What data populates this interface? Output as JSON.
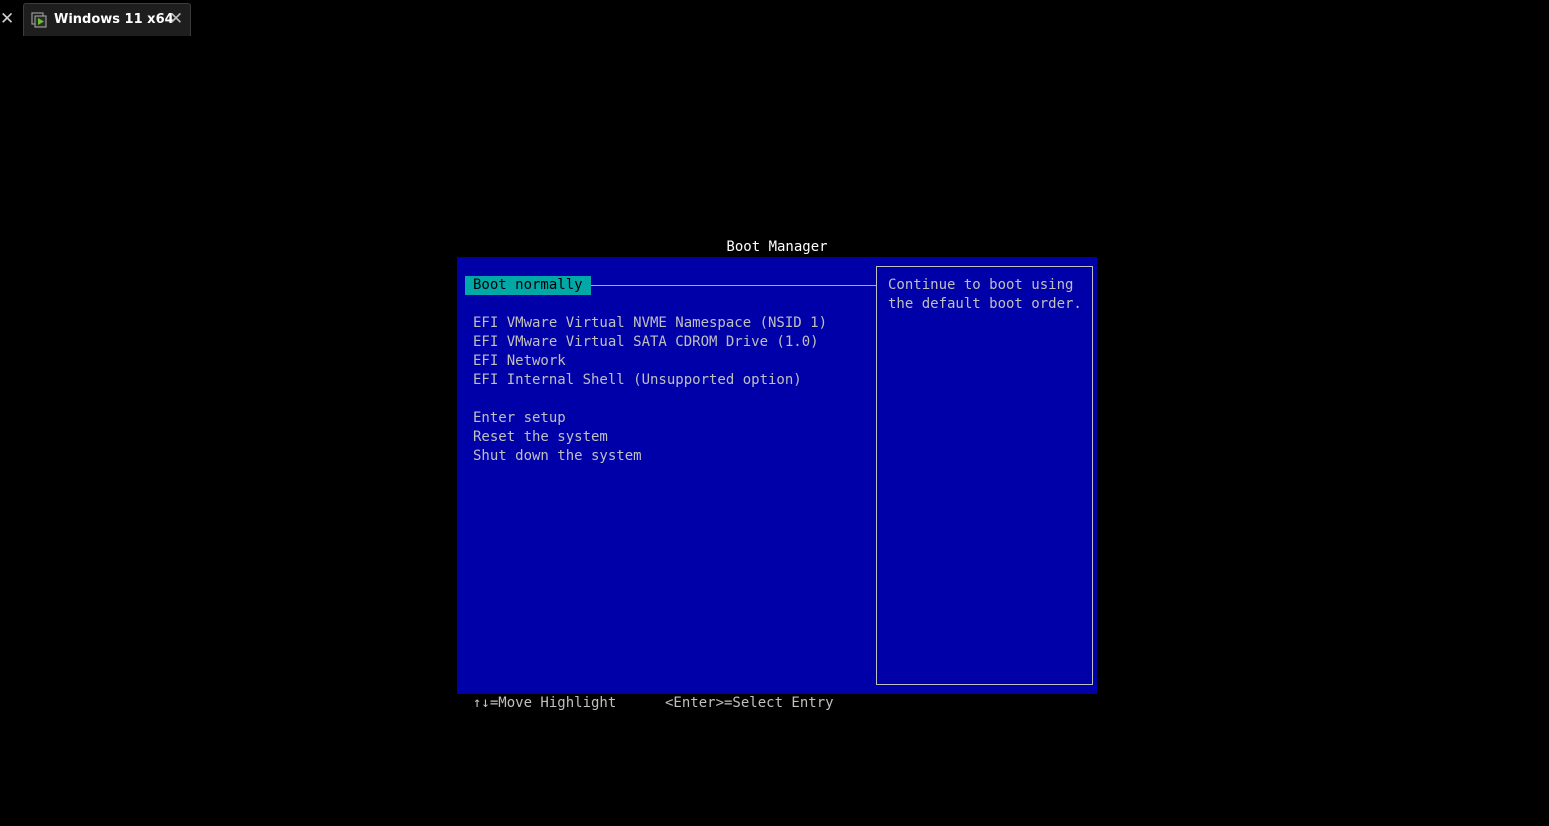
{
  "window": {
    "tab_title": "Windows 11 x64",
    "tab_icon": "vm-icon",
    "close_glyph": "✕"
  },
  "boot_manager": {
    "title": "Boot Manager",
    "items": [
      {
        "label": "Boot normally",
        "selected": true
      },
      {
        "label": "EFI VMware Virtual NVME Namespace (NSID 1)",
        "selected": false
      },
      {
        "label": "EFI VMware Virtual SATA CDROM Drive (1.0)",
        "selected": false
      },
      {
        "label": "EFI Network",
        "selected": false
      },
      {
        "label": "EFI Internal Shell (Unsupported option)",
        "selected": false
      },
      {
        "label": "Enter setup",
        "selected": false
      },
      {
        "label": "Reset the system",
        "selected": false
      },
      {
        "label": "Shut down the system",
        "selected": false
      }
    ],
    "help_text": "Continue to boot using\nthe default boot order.",
    "footer": {
      "move_hint": "↑↓=Move Highlight",
      "select_hint": "<Enter>=Select Entry"
    }
  },
  "colors": {
    "panel_bg": "#0000a8",
    "highlight_bg": "#00a8a8",
    "text": "#c0c0c0",
    "screen_bg": "#000000"
  }
}
